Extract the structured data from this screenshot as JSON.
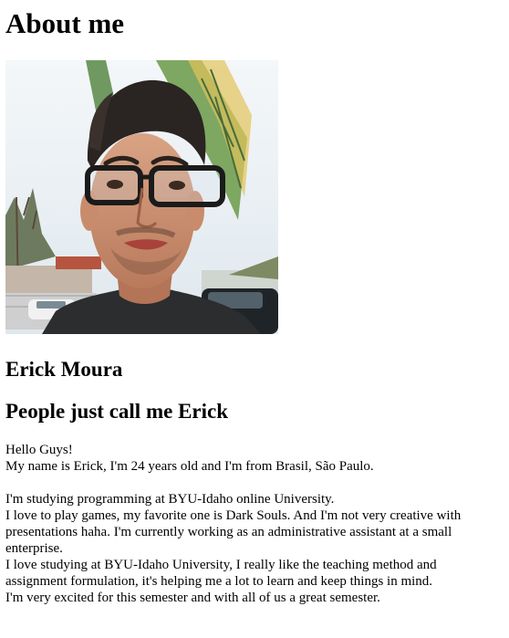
{
  "page": {
    "title": "About me",
    "name_heading": "Erick Moura",
    "nickname_heading": "People just call me Erick"
  },
  "photo": {
    "alt": "Portrait photo of Erick Moura wearing glasses, with palm leaves behind him"
  },
  "bio": {
    "paragraph1": {
      "line1": "Hello Guys!",
      "line2": "My name is Erick, I'm 24 years old and I'm from Brasil, São Paulo."
    },
    "paragraph2": {
      "line1": "I'm studying programming at BYU-Idaho online University.",
      "line2": "I love to play games, my favorite one is Dark Souls. And I'm not very creative with presentations haha. I'm currently working as an administrative assistant at a small enterprise.",
      "line3": "I love studying at BYU-Idaho University, I really like the teaching method and assignment formulation, it's helping me a lot to learn and keep things in mind.",
      "line4": "I'm very excited for this semester and with all of us a great semester."
    }
  }
}
